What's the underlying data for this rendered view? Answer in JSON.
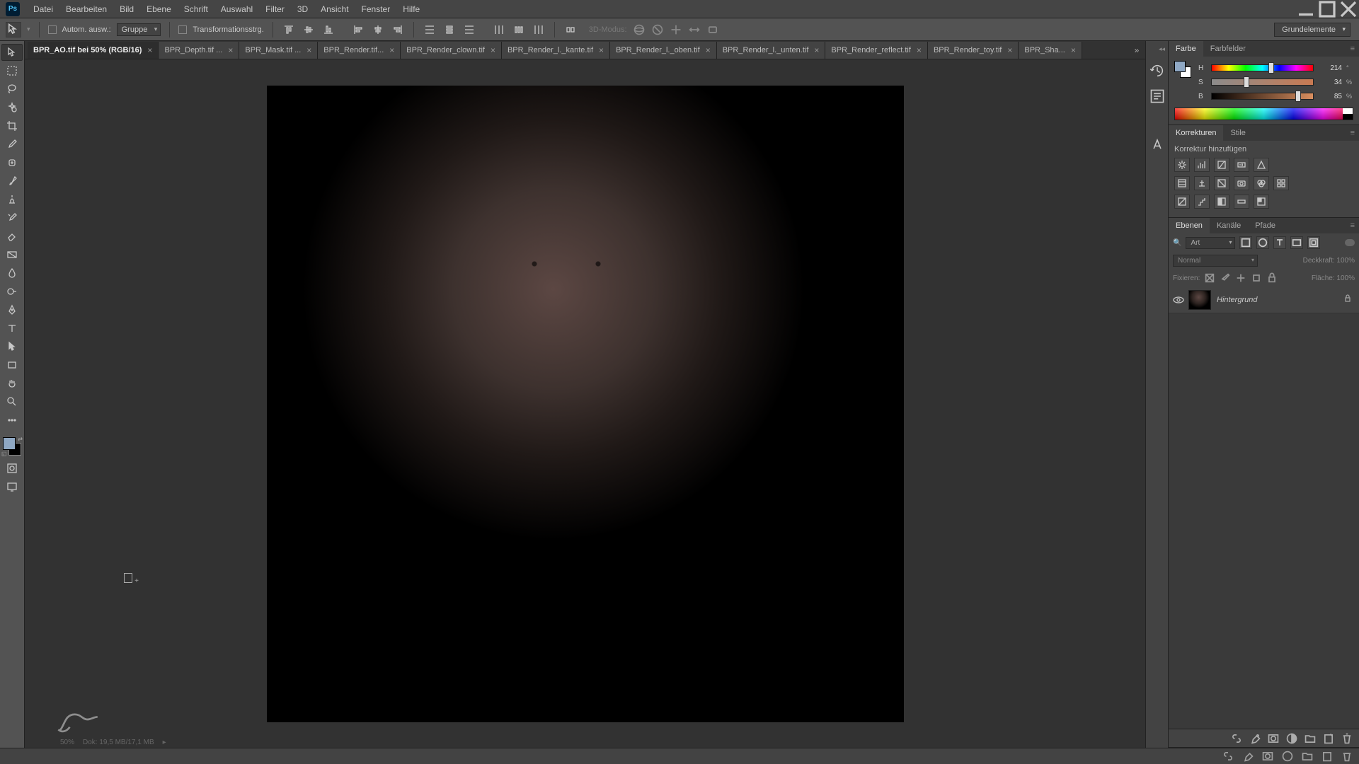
{
  "menubar": [
    "Datei",
    "Bearbeiten",
    "Bild",
    "Ebene",
    "Schrift",
    "Auswahl",
    "Filter",
    "3D",
    "Ansicht",
    "Fenster",
    "Hilfe"
  ],
  "options": {
    "auto_select_label": "Autom. ausw.:",
    "group_dropdown": "Gruppe",
    "transform_label": "Transformationsstrg.",
    "mode_label": "3D-Modus:",
    "workspace": "Grundelemente"
  },
  "tabs": [
    {
      "title": "BPR_AO.tif bei 50% (RGB/16)",
      "active": true
    },
    {
      "title": "BPR_Depth.tif ...",
      "active": false
    },
    {
      "title": "BPR_Mask.tif ...",
      "active": false
    },
    {
      "title": "BPR_Render.tif...",
      "active": false
    },
    {
      "title": "BPR_Render_clown.tif",
      "active": false
    },
    {
      "title": "BPR_Render_l._kante.tif",
      "active": false
    },
    {
      "title": "BPR_Render_l._oben.tif",
      "active": false
    },
    {
      "title": "BPR_Render_l._unten.tif",
      "active": false
    },
    {
      "title": "BPR_Render_reflect.tif",
      "active": false
    },
    {
      "title": "BPR_Render_toy.tif",
      "active": false
    },
    {
      "title": "BPR_Sha...",
      "active": false
    }
  ],
  "color_panel": {
    "tabs": [
      "Farbe",
      "Farbfelder"
    ],
    "sliders": {
      "H": {
        "value": "214",
        "unit": "°",
        "pos": 59
      },
      "S": {
        "value": "34",
        "unit": "%",
        "pos": 34
      },
      "B": {
        "value": "85",
        "unit": "%",
        "pos": 85
      }
    }
  },
  "adjustments_panel": {
    "tabs": [
      "Korrekturen",
      "Stile"
    ],
    "subtitle": "Korrektur hinzufügen"
  },
  "layers_panel": {
    "tabs": [
      "Ebenen",
      "Kanäle",
      "Pfade"
    ],
    "filter_kind": "Art",
    "blend_mode": "Normal",
    "opacity_label": "Deckkraft:",
    "opacity_value": "100%",
    "fix_label": "Fixieren:",
    "fill_label": "Fläche:",
    "fill_value": "100%",
    "layers": [
      {
        "name": "Hintergrund",
        "locked": true
      }
    ],
    "search_placeholder": "Art"
  },
  "status": {
    "zoom": "50%",
    "doc_info": "Dok: 19,5 MB/17,1 MB"
  }
}
